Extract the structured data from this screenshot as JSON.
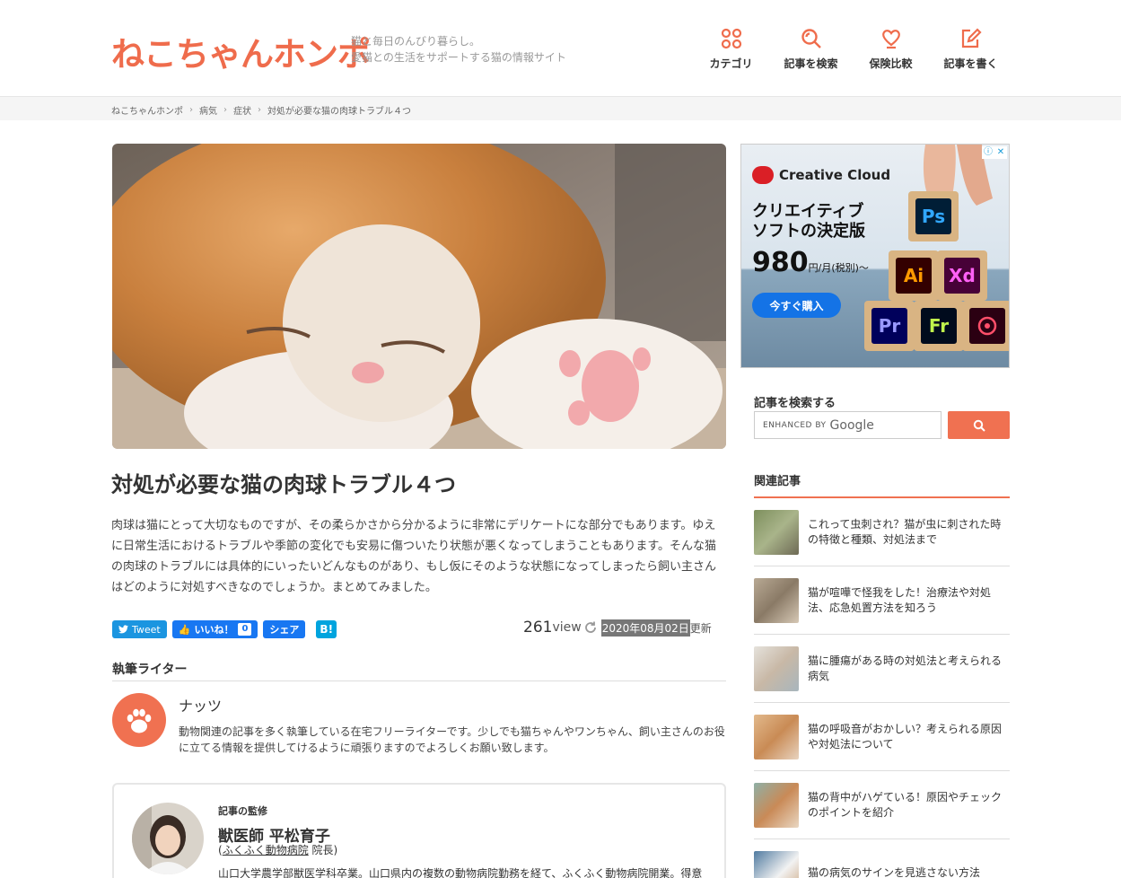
{
  "site": {
    "logo": "ねこちゃんホンポ",
    "tagline_1": "猫と毎日のんびり暮らし。",
    "tagline_2": "愛猫との生活をサポートする猫の情報サイト"
  },
  "nav": [
    {
      "label": "カテゴリ",
      "icon": "grid-icon"
    },
    {
      "label": "記事を検索",
      "icon": "search-icon"
    },
    {
      "label": "保険比較",
      "icon": "heart-icon"
    },
    {
      "label": "記事を書く",
      "icon": "pencil-icon"
    }
  ],
  "breadcrumb": [
    "ねこちゃんホンポ",
    "病気",
    "症状",
    "対処が必要な猫の肉球トラブル４つ"
  ],
  "article": {
    "title": "対処が必要な猫の肉球トラブル４つ",
    "intro": "肉球は猫にとって大切なものですが、その柔らかさから分かるように非常にデリケートにな部分でもあります。ゆえに日常生活におけるトラブルや季節の変化でも安易に傷ついたり状態が悪くなってしまうこともあります。そんな猫の肉球のトラブルには具体的にいったいどんなものがあり、もし仮にそのような状態になってしまったら飼い主さんはどのように対処すべきなのでしょうか。まとめてみました。",
    "views": "261",
    "views_label": "view",
    "date": "2020年08月02日",
    "updated_label": "更新"
  },
  "share": {
    "tweet": "Tweet",
    "like": "いいね！",
    "like_count": "0",
    "share": "シェア",
    "hatena": "B!"
  },
  "writer": {
    "heading": "執筆ライター",
    "name": "ナッツ",
    "bio": "動物関連の記事を多く執筆している在宅フリーライターです。少しでも猫ちゃんやワンちゃん、飼い主さんのお役に立てる情報を提供してけるように頑張りますのでよろしくお願い致します。"
  },
  "supervisor": {
    "label": "記事の監修",
    "name": "獣医師 平松育子",
    "clinic_open": "(",
    "clinic_link": "ふくふく動物病院",
    "clinic_role": " 院長)",
    "bio": "山口大学農学部獣医学科卒業。山口県内の複数の動物病院勤務を経て、ふくふく動物病院開業。得意"
  },
  "ad": {
    "brand": "Creative Cloud",
    "headline_1": "クリエイティブ",
    "headline_2": "ソフトの決定版",
    "price": "980",
    "price_unit": "円/月(税別)～",
    "buy": "今すぐ購入",
    "apps": [
      "Ps",
      "Ai",
      "Xd",
      "Pr",
      "Fr"
    ]
  },
  "sidebar": {
    "search_title": "記事を検索する",
    "search_enhanced": "ENHANCED BY",
    "search_google": "Google",
    "related_title": "関連記事",
    "related": [
      {
        "text": "これって虫刺され？猫が虫に刺された時の特徴と種類、対処法まで",
        "color": "#8a9a6b"
      },
      {
        "text": "猫が喧嘩で怪我をした！治療法や対処法、応急処置方法を知ろう",
        "color": "#9c8f80"
      },
      {
        "text": "猫に腫瘍がある時の対処法と考えられる病気",
        "color": "#c7b9a9"
      },
      {
        "text": "猫の呼吸音がおかしい？考えられる原因や対処法について",
        "color": "#c98b55"
      },
      {
        "text": "猫の背中がハゲている！原因やチェックのポイントを紹介",
        "color": "#b87a4a"
      },
      {
        "text": "猫の病気のサインを見逃さない方法",
        "color": "#4f7aa0"
      }
    ]
  },
  "colors": {
    "brand": "#ef6c4c",
    "accent": "#f07151"
  }
}
